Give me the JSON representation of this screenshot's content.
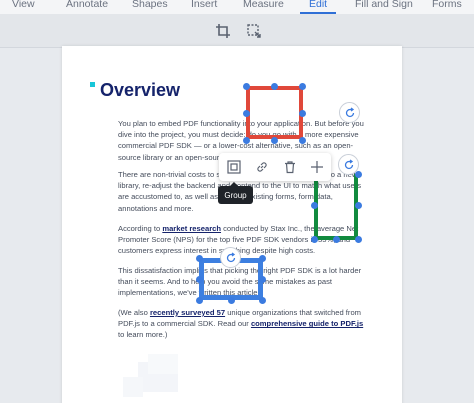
{
  "menu": {
    "tabs": [
      {
        "label": "View"
      },
      {
        "label": "Annotate"
      },
      {
        "label": "Shapes"
      },
      {
        "label": "Insert"
      },
      {
        "label": "Measure"
      },
      {
        "label": "Edit",
        "active": true
      },
      {
        "label": "Fill and Sign"
      },
      {
        "label": "Forms"
      }
    ]
  },
  "subtoolbar": {
    "tools": [
      {
        "icon": "crop-icon"
      },
      {
        "icon": "crop-select-icon"
      }
    ]
  },
  "document": {
    "title": "Overview",
    "paragraphs": {
      "p1": "You plan to embed PDF functionality into your application. But before you dive into the project, you must decide: do you go with a more expensive commercial PDF SDK — or a lower-cost alternative, such as an open-source library or an open-source wrapper?",
      "p2": "There are non-trivial costs to switching. If you decide to switch to a new library, re-adjust the backend and frontend to the UI to match what users are accustomed to, as well as migrate existing forms, form data, annotations and more.",
      "p3_link": "market research",
      "p3_a": "According to ",
      "p3_b": " conducted by Stax Inc., the average Net Promoter Score (NPS) for the top five PDF SDK vendors is 35%, and customers express interest in switching despite high costs.",
      "p4": "This dissatisfaction implies that picking the right PDF SDK is a lot harder than it seems. And to help you avoid the same mistakes as past implementations, we've written this article.",
      "p5_a": "(We also ",
      "p5_link1": "recently surveyed 57",
      "p5_b": " unique organizations that switched from PDF.js to a commercial SDK. Read our ",
      "p5_link2": "comprehensive guide to PDF.js",
      "p5_c": " to learn more.)"
    }
  },
  "popup": {
    "buttons": [
      {
        "icon": "group-icon"
      },
      {
        "icon": "link-icon"
      },
      {
        "icon": "trash-icon"
      },
      {
        "icon": "move-icon"
      }
    ],
    "tooltip": "Group"
  },
  "colors": {
    "accent": "#2f6fd6",
    "red_shape": "#e0483a",
    "green_shape": "#118a3e",
    "blue_shape": "#3d7fe0",
    "handle": "#3b7be0",
    "title": "#15236b"
  }
}
